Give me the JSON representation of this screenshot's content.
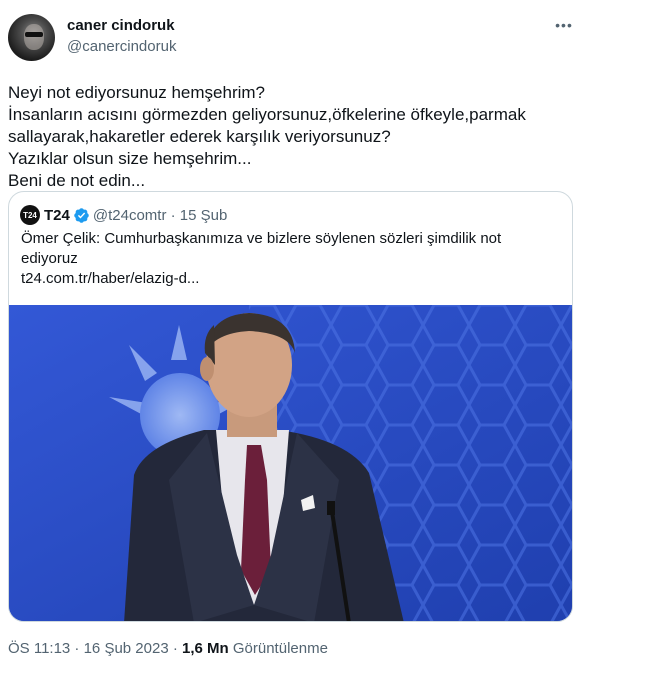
{
  "author": {
    "display_name": "caner cindoruk",
    "handle": "@canercindoruk"
  },
  "more_label": "•••",
  "tweet_lines": [
    "Neyi not ediyorsunuz hemşehrim?",
    "İnsanların acısını görmezden geliyorsunuz,öfkelerine öfkeyle,parmak",
    "sallayarak,hakaretler ederek karşılık veriyorsunuz?",
    "Yazıklar olsun size hemşehrim...",
    "Beni de not edin..."
  ],
  "quote": {
    "logo_text": "T24",
    "name": "T24",
    "handle_date": "@t24comtr · 15 Şub",
    "text": "Ömer Çelik: Cumhurbaşkanımıza ve bizlere söylenen sözleri şimdilik not ediyoruz",
    "link": "t24.com.tr/haber/elazig-d..."
  },
  "meta": {
    "time_date": "ÖS 11:13 · 16 Şub 2023 · ",
    "views_count": "1,6 Mn",
    "views_label": " Görüntülenme"
  },
  "colors": {
    "text": "#0f1419",
    "secondary": "#536471",
    "border": "#cfd9de",
    "verified": "#1d9bf0",
    "photo_background": "#2a4fc4"
  }
}
